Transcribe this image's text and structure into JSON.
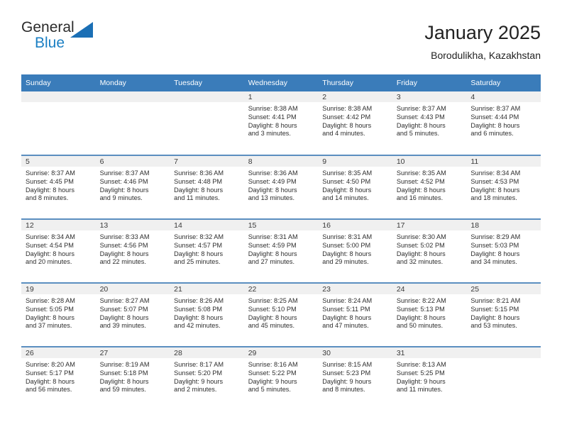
{
  "brand": {
    "name_part1": "General",
    "name_part2": "Blue",
    "accent_color": "#1b7fc3",
    "triangle_color": "#1b6fb5"
  },
  "header": {
    "title": "January 2025",
    "location": "Borodulikha, Kazakhstan"
  },
  "calendar": {
    "header_color": "#3a7cba",
    "daynum_band_color": "#f0f0f0",
    "week_separator_color": "#5b8fc0",
    "weekday_headers": [
      "Sunday",
      "Monday",
      "Tuesday",
      "Wednesday",
      "Thursday",
      "Friday",
      "Saturday"
    ],
    "weeks": [
      [
        {
          "day": "",
          "sunrise": "",
          "sunset": "",
          "daylight_line1": "",
          "daylight_line2": "",
          "empty": true
        },
        {
          "day": "",
          "sunrise": "",
          "sunset": "",
          "daylight_line1": "",
          "daylight_line2": "",
          "empty": true
        },
        {
          "day": "",
          "sunrise": "",
          "sunset": "",
          "daylight_line1": "",
          "daylight_line2": "",
          "empty": true
        },
        {
          "day": "1",
          "sunrise": "Sunrise: 8:38 AM",
          "sunset": "Sunset: 4:41 PM",
          "daylight_line1": "Daylight: 8 hours",
          "daylight_line2": "and 3 minutes."
        },
        {
          "day": "2",
          "sunrise": "Sunrise: 8:38 AM",
          "sunset": "Sunset: 4:42 PM",
          "daylight_line1": "Daylight: 8 hours",
          "daylight_line2": "and 4 minutes."
        },
        {
          "day": "3",
          "sunrise": "Sunrise: 8:37 AM",
          "sunset": "Sunset: 4:43 PM",
          "daylight_line1": "Daylight: 8 hours",
          "daylight_line2": "and 5 minutes."
        },
        {
          "day": "4",
          "sunrise": "Sunrise: 8:37 AM",
          "sunset": "Sunset: 4:44 PM",
          "daylight_line1": "Daylight: 8 hours",
          "daylight_line2": "and 6 minutes."
        }
      ],
      [
        {
          "day": "5",
          "sunrise": "Sunrise: 8:37 AM",
          "sunset": "Sunset: 4:45 PM",
          "daylight_line1": "Daylight: 8 hours",
          "daylight_line2": "and 8 minutes."
        },
        {
          "day": "6",
          "sunrise": "Sunrise: 8:37 AM",
          "sunset": "Sunset: 4:46 PM",
          "daylight_line1": "Daylight: 8 hours",
          "daylight_line2": "and 9 minutes."
        },
        {
          "day": "7",
          "sunrise": "Sunrise: 8:36 AM",
          "sunset": "Sunset: 4:48 PM",
          "daylight_line1": "Daylight: 8 hours",
          "daylight_line2": "and 11 minutes."
        },
        {
          "day": "8",
          "sunrise": "Sunrise: 8:36 AM",
          "sunset": "Sunset: 4:49 PM",
          "daylight_line1": "Daylight: 8 hours",
          "daylight_line2": "and 13 minutes."
        },
        {
          "day": "9",
          "sunrise": "Sunrise: 8:35 AM",
          "sunset": "Sunset: 4:50 PM",
          "daylight_line1": "Daylight: 8 hours",
          "daylight_line2": "and 14 minutes."
        },
        {
          "day": "10",
          "sunrise": "Sunrise: 8:35 AM",
          "sunset": "Sunset: 4:52 PM",
          "daylight_line1": "Daylight: 8 hours",
          "daylight_line2": "and 16 minutes."
        },
        {
          "day": "11",
          "sunrise": "Sunrise: 8:34 AM",
          "sunset": "Sunset: 4:53 PM",
          "daylight_line1": "Daylight: 8 hours",
          "daylight_line2": "and 18 minutes."
        }
      ],
      [
        {
          "day": "12",
          "sunrise": "Sunrise: 8:34 AM",
          "sunset": "Sunset: 4:54 PM",
          "daylight_line1": "Daylight: 8 hours",
          "daylight_line2": "and 20 minutes."
        },
        {
          "day": "13",
          "sunrise": "Sunrise: 8:33 AM",
          "sunset": "Sunset: 4:56 PM",
          "daylight_line1": "Daylight: 8 hours",
          "daylight_line2": "and 22 minutes."
        },
        {
          "day": "14",
          "sunrise": "Sunrise: 8:32 AM",
          "sunset": "Sunset: 4:57 PM",
          "daylight_line1": "Daylight: 8 hours",
          "daylight_line2": "and 25 minutes."
        },
        {
          "day": "15",
          "sunrise": "Sunrise: 8:31 AM",
          "sunset": "Sunset: 4:59 PM",
          "daylight_line1": "Daylight: 8 hours",
          "daylight_line2": "and 27 minutes."
        },
        {
          "day": "16",
          "sunrise": "Sunrise: 8:31 AM",
          "sunset": "Sunset: 5:00 PM",
          "daylight_line1": "Daylight: 8 hours",
          "daylight_line2": "and 29 minutes."
        },
        {
          "day": "17",
          "sunrise": "Sunrise: 8:30 AM",
          "sunset": "Sunset: 5:02 PM",
          "daylight_line1": "Daylight: 8 hours",
          "daylight_line2": "and 32 minutes."
        },
        {
          "day": "18",
          "sunrise": "Sunrise: 8:29 AM",
          "sunset": "Sunset: 5:03 PM",
          "daylight_line1": "Daylight: 8 hours",
          "daylight_line2": "and 34 minutes."
        }
      ],
      [
        {
          "day": "19",
          "sunrise": "Sunrise: 8:28 AM",
          "sunset": "Sunset: 5:05 PM",
          "daylight_line1": "Daylight: 8 hours",
          "daylight_line2": "and 37 minutes."
        },
        {
          "day": "20",
          "sunrise": "Sunrise: 8:27 AM",
          "sunset": "Sunset: 5:07 PM",
          "daylight_line1": "Daylight: 8 hours",
          "daylight_line2": "and 39 minutes."
        },
        {
          "day": "21",
          "sunrise": "Sunrise: 8:26 AM",
          "sunset": "Sunset: 5:08 PM",
          "daylight_line1": "Daylight: 8 hours",
          "daylight_line2": "and 42 minutes."
        },
        {
          "day": "22",
          "sunrise": "Sunrise: 8:25 AM",
          "sunset": "Sunset: 5:10 PM",
          "daylight_line1": "Daylight: 8 hours",
          "daylight_line2": "and 45 minutes."
        },
        {
          "day": "23",
          "sunrise": "Sunrise: 8:24 AM",
          "sunset": "Sunset: 5:11 PM",
          "daylight_line1": "Daylight: 8 hours",
          "daylight_line2": "and 47 minutes."
        },
        {
          "day": "24",
          "sunrise": "Sunrise: 8:22 AM",
          "sunset": "Sunset: 5:13 PM",
          "daylight_line1": "Daylight: 8 hours",
          "daylight_line2": "and 50 minutes."
        },
        {
          "day": "25",
          "sunrise": "Sunrise: 8:21 AM",
          "sunset": "Sunset: 5:15 PM",
          "daylight_line1": "Daylight: 8 hours",
          "daylight_line2": "and 53 minutes."
        }
      ],
      [
        {
          "day": "26",
          "sunrise": "Sunrise: 8:20 AM",
          "sunset": "Sunset: 5:17 PM",
          "daylight_line1": "Daylight: 8 hours",
          "daylight_line2": "and 56 minutes."
        },
        {
          "day": "27",
          "sunrise": "Sunrise: 8:19 AM",
          "sunset": "Sunset: 5:18 PM",
          "daylight_line1": "Daylight: 8 hours",
          "daylight_line2": "and 59 minutes."
        },
        {
          "day": "28",
          "sunrise": "Sunrise: 8:17 AM",
          "sunset": "Sunset: 5:20 PM",
          "daylight_line1": "Daylight: 9 hours",
          "daylight_line2": "and 2 minutes."
        },
        {
          "day": "29",
          "sunrise": "Sunrise: 8:16 AM",
          "sunset": "Sunset: 5:22 PM",
          "daylight_line1": "Daylight: 9 hours",
          "daylight_line2": "and 5 minutes."
        },
        {
          "day": "30",
          "sunrise": "Sunrise: 8:15 AM",
          "sunset": "Sunset: 5:23 PM",
          "daylight_line1": "Daylight: 9 hours",
          "daylight_line2": "and 8 minutes."
        },
        {
          "day": "31",
          "sunrise": "Sunrise: 8:13 AM",
          "sunset": "Sunset: 5:25 PM",
          "daylight_line1": "Daylight: 9 hours",
          "daylight_line2": "and 11 minutes."
        },
        {
          "day": "",
          "sunrise": "",
          "sunset": "",
          "daylight_line1": "",
          "daylight_line2": "",
          "empty": true
        }
      ]
    ]
  }
}
